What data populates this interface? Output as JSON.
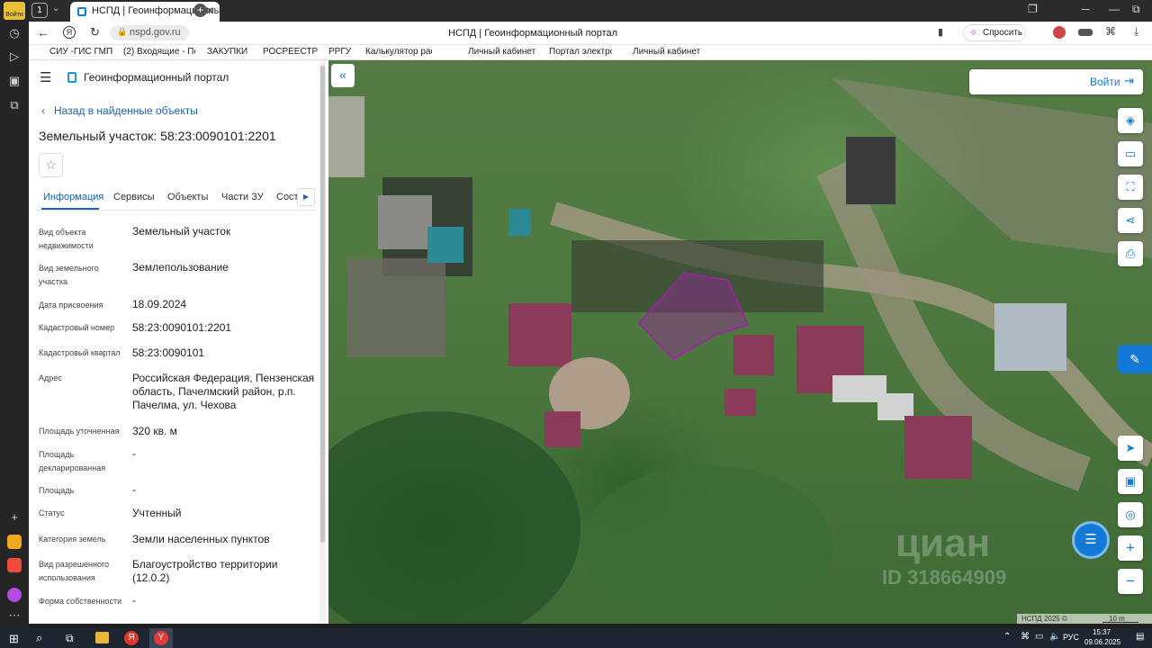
{
  "browser": {
    "tab_count": "1",
    "tab_title": "НСПД | Геоинформационный",
    "url": "nspd.gov.ru",
    "page_title": "НСПД | Геоинформационный портал",
    "ask_label": "Спросить",
    "rail_login": "Войти",
    "bookmarks": [
      "СИУ -ГИС ГМП",
      "(2) Входящие - По",
      "ЗАКУПКИ",
      "РОСРЕЕСТР",
      "РРГУ",
      "Калькулятор рас",
      "Личный кабинет",
      "Портал электрос",
      "Личный кабинет"
    ]
  },
  "panel": {
    "portal_title": "Геоинформационный портал",
    "back_label": "Назад в найденные объекты",
    "object_title": "Земельный участок: 58:23:0090101:2201",
    "tabs": [
      "Информация",
      "Сервисы",
      "Объекты",
      "Части ЗУ",
      "Соста"
    ],
    "fields": [
      {
        "label": "Вид объекта недвижимости",
        "value": "Земельный участок"
      },
      {
        "label": "Вид земельного участка",
        "value": "Землепользование"
      },
      {
        "label": "Дата присвоения",
        "value": "18.09.2024"
      },
      {
        "label": "Кадастровый номер",
        "value": "58:23:0090101:2201"
      },
      {
        "label": "Кадастровый квартал",
        "value": "58:23:0090101"
      },
      {
        "label": "Адрес",
        "value": "Российская Федерация, Пензенская область, Пачелмский район, р.п. Пачелма, ул. Чехова"
      },
      {
        "label": "Площадь уточненная",
        "value": "320 кв. м"
      },
      {
        "label": "Площадь декларированная",
        "value": "-"
      },
      {
        "label": "Площадь",
        "value": "-"
      },
      {
        "label": "Статус",
        "value": "Учтенный"
      },
      {
        "label": "Категория земель",
        "value": "Земли населенных пунктов"
      },
      {
        "label": "Вид разрешенного использования",
        "value": "Благоустройство территории (12.0.2)"
      },
      {
        "label": "Форма собственности",
        "value": "-"
      }
    ]
  },
  "map": {
    "login_label": "Войти",
    "watermark_brand": "циан",
    "watermark_id": "ID 318664909",
    "copyright": "НСПД 2025 ©",
    "scale": "10 m",
    "parcel_color": "#a020a8"
  },
  "taskbar": {
    "lang": "РУС",
    "time": "15:37",
    "date": "09.06.2025"
  }
}
